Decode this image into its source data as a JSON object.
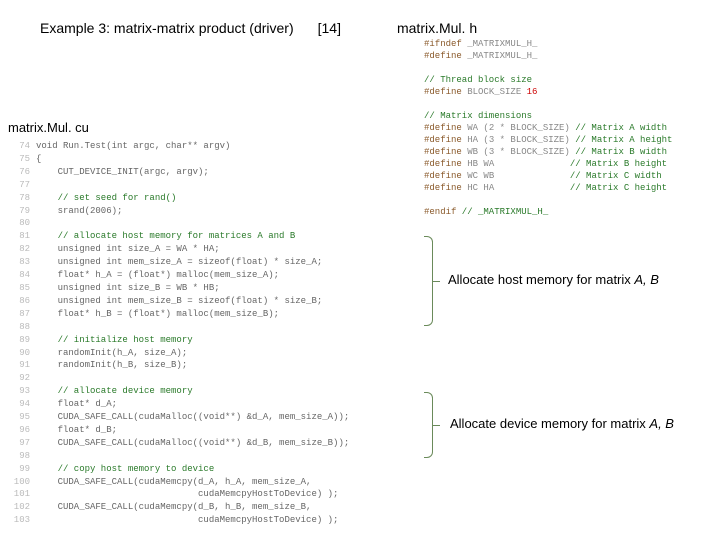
{
  "title": "Example 3: matrix-matrix product (driver)",
  "ref": "[14]",
  "file_h": "matrix.Mul. h",
  "file_cu": "matrix.Mul. cu",
  "anno1_a": "Allocate host memory for matrix ",
  "anno1_b": "A, B",
  "anno2_a": "Allocate device memory for matrix ",
  "anno2_b": "A, B",
  "h": {
    "l1a": "#ifndef",
    "l1b": " _MATRIXMUL_H_",
    "l2a": "#define",
    "l2b": " _MATRIXMUL_H_",
    "l3": "// Thread block size",
    "l4a": "#define",
    "l4b": " BLOCK_SIZE ",
    "l4c": "16",
    "l5": "// Matrix dimensions",
    "l6a": "#define",
    "l6b": " WA (2 * BLOCK_SIZE) ",
    "l6c": "// Matrix A width",
    "l7a": "#define",
    "l7b": " HA (3 * BLOCK_SIZE) ",
    "l7c": "// Matrix A height",
    "l8a": "#define",
    "l8b": " WB (3 * BLOCK_SIZE) ",
    "l8c": "// Matrix B width",
    "l9a": "#define",
    "l9b": " HB WA              ",
    "l9c": "// Matrix B height",
    "l10a": "#define",
    "l10b": " WC WB              ",
    "l10c": "// Matrix C width",
    "l11a": "#define",
    "l11b": " HC HA              ",
    "l11c": "// Matrix C height",
    "l12a": "#endif",
    "l12b": " // _MATRIXMUL_H_"
  },
  "cu": {
    "n74": "74",
    "l74": "void Run.Test(int argc, char** argv)",
    "n75": "75",
    "l75": "{",
    "n76": "76",
    "l76": "    CUT_DEVICE_INIT(argc, argv);",
    "n77": "77",
    "l77": "",
    "n78": "78",
    "l78c": "    // set seed for rand()",
    "n79": "79",
    "l79": "    srand(2006);",
    "n80": "80",
    "l80": "",
    "n81": "81",
    "l81c": "    // allocate host memory for matrices A and B",
    "n82": "82",
    "l82": "    unsigned int size_A = WA * HA;",
    "n83": "83",
    "l83": "    unsigned int mem_size_A = sizeof(float) * size_A;",
    "n84": "84",
    "l84": "    float* h_A = (float*) malloc(mem_size_A);",
    "n85": "85",
    "l85": "    unsigned int size_B = WB * HB;",
    "n86": "86",
    "l86": "    unsigned int mem_size_B = sizeof(float) * size_B;",
    "n87": "87",
    "l87": "    float* h_B = (float*) malloc(mem_size_B);",
    "n88": "88",
    "l88": "",
    "n89": "89",
    "l89c": "    // initialize host memory",
    "n90": "90",
    "l90": "    randomInit(h_A, size_A);",
    "n91": "91",
    "l91": "    randomInit(h_B, size_B);",
    "n92": "92",
    "l92": "",
    "n93": "93",
    "l93c": "    // allocate device memory",
    "n94": "94",
    "l94": "    float* d_A;",
    "n95": "95",
    "l95": "    CUDA_SAFE_CALL(cudaMalloc((void**) &d_A, mem_size_A));",
    "n96": "96",
    "l96": "    float* d_B;",
    "n97": "97",
    "l97": "    CUDA_SAFE_CALL(cudaMalloc((void**) &d_B, mem_size_B));",
    "n98": "98",
    "l98": "",
    "n99": "99",
    "l99c": "    // copy host memory to device",
    "n100": "100",
    "l100": "    CUDA_SAFE_CALL(cudaMemcpy(d_A, h_A, mem_size_A,",
    "n101": "101",
    "l101": "                              cudaMemcpyHostToDevice) );",
    "n102": "102",
    "l102": "    CUDA_SAFE_CALL(cudaMemcpy(d_B, h_B, mem_size_B,",
    "n103": "103",
    "l103": "                              cudaMemcpyHostToDevice) );"
  }
}
